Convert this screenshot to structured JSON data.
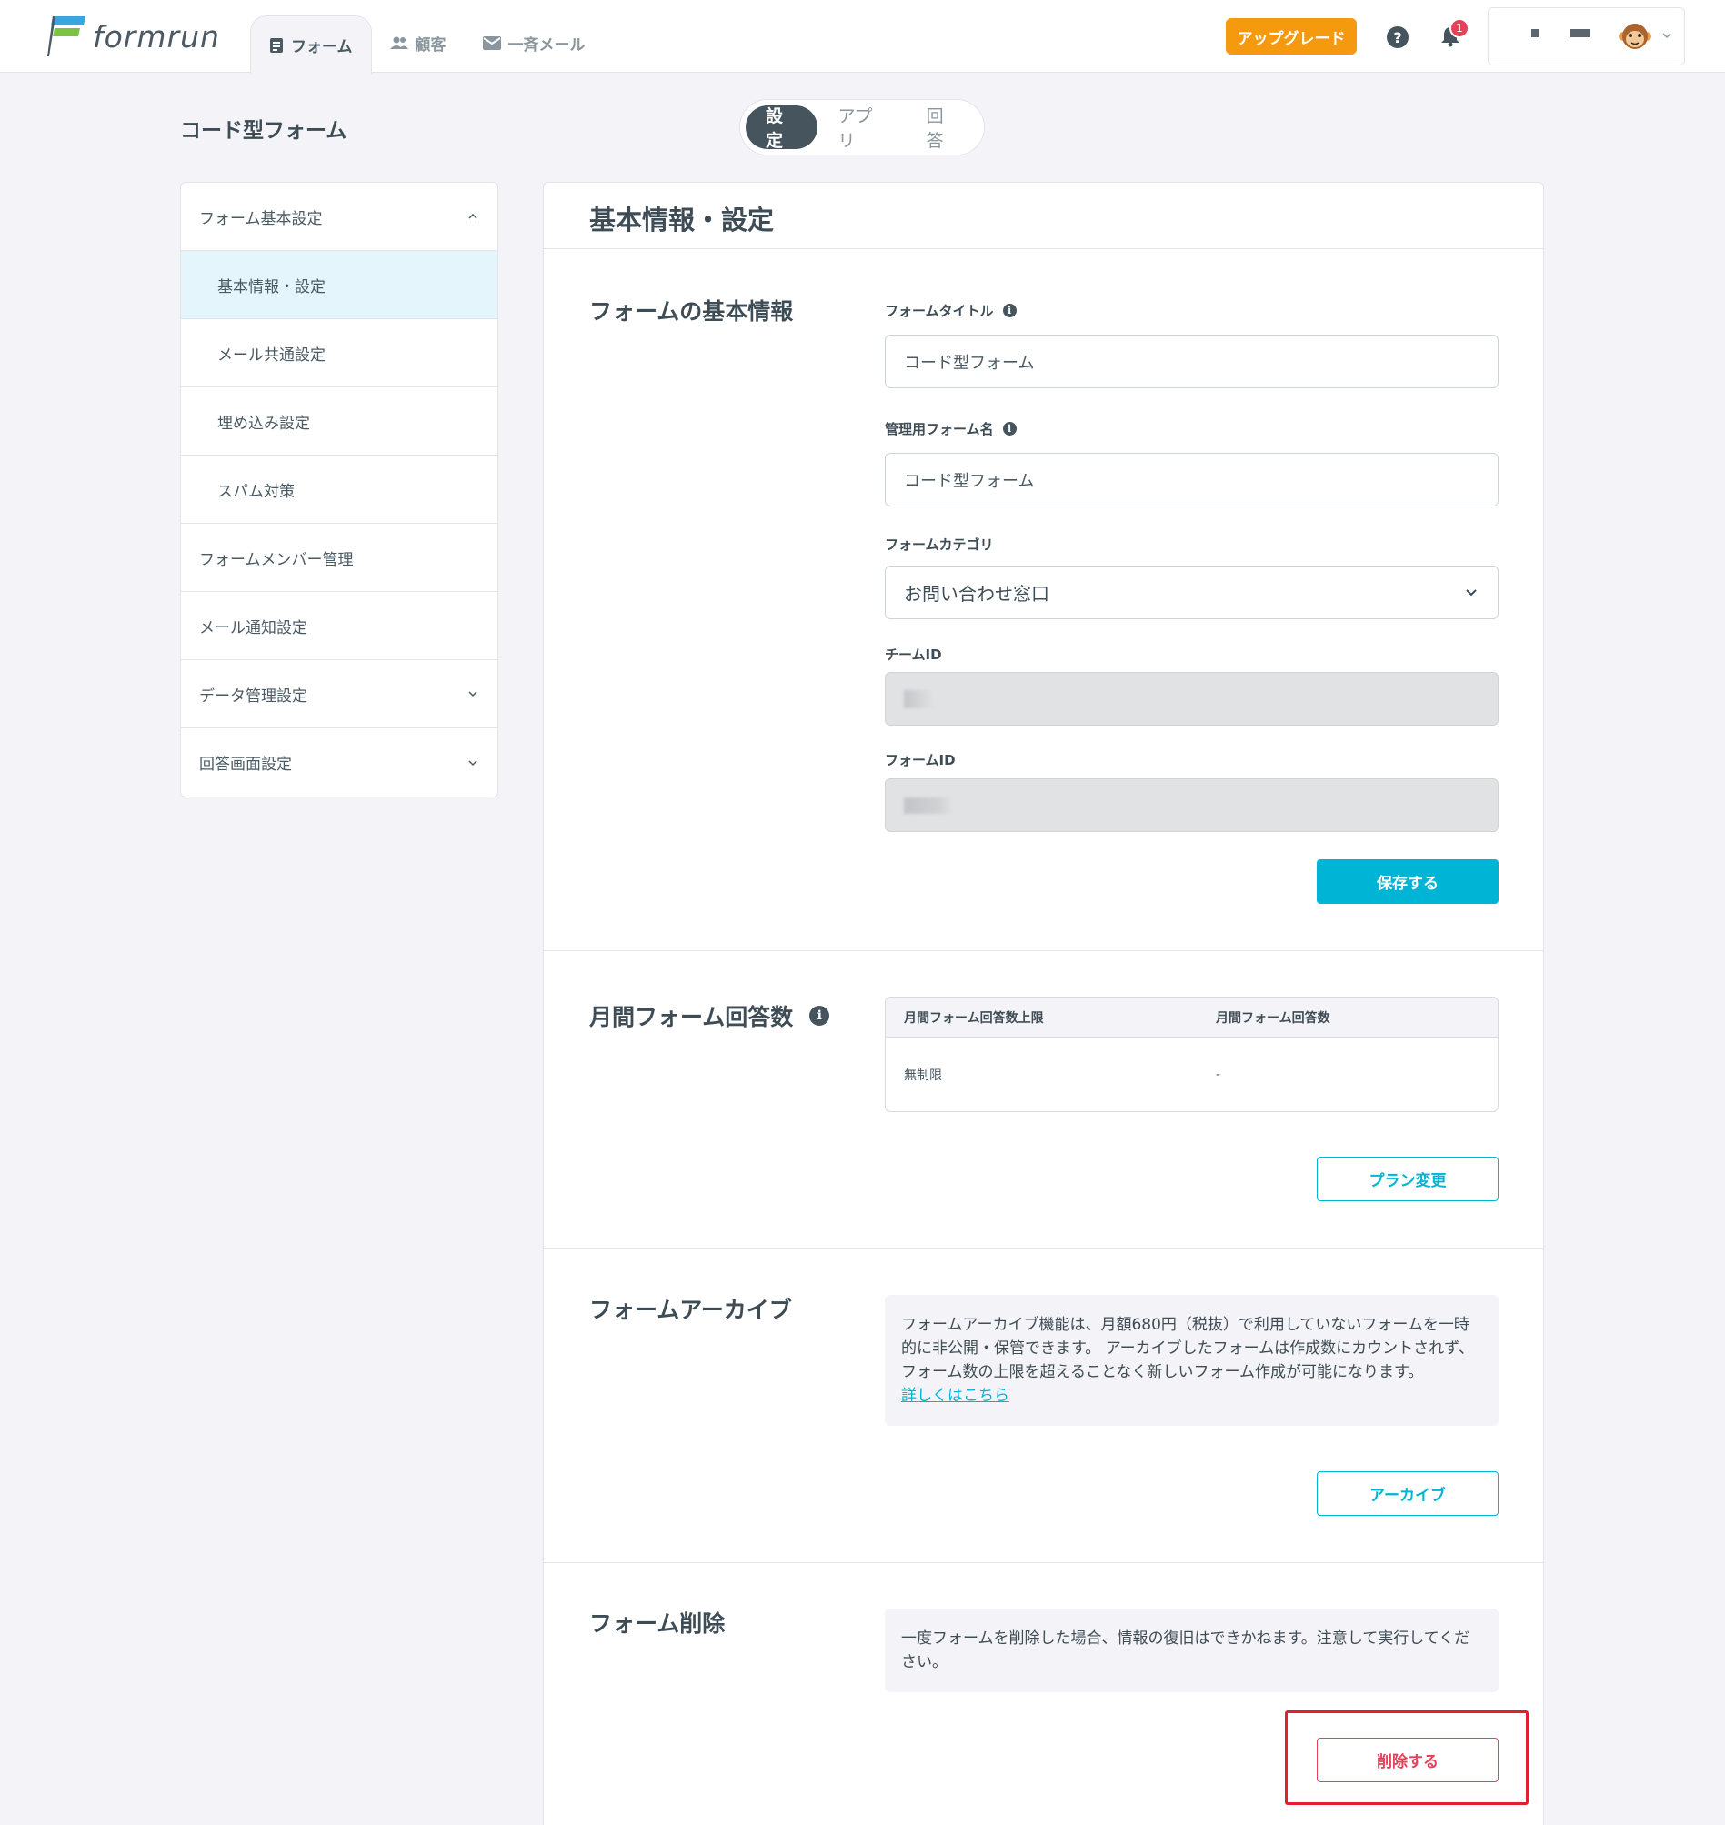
{
  "header": {
    "logo_text": "formrun",
    "tabs": [
      {
        "label": "フォーム",
        "icon": "document-icon",
        "active": true
      },
      {
        "label": "顧客",
        "icon": "people-icon",
        "active": false
      },
      {
        "label": "一斉メール",
        "icon": "mail-icon",
        "active": false
      }
    ],
    "upgrade_label": "アップグレード",
    "help_label": "?",
    "notification_count": "1"
  },
  "page": {
    "title": "コード型フォーム",
    "segments": [
      {
        "label": "設定",
        "active": true
      },
      {
        "label": "アプリ",
        "active": false
      },
      {
        "label": "回答",
        "active": false
      }
    ]
  },
  "sidebar": {
    "items": [
      {
        "label": "フォーム基本設定",
        "sub": false,
        "active": false,
        "chevron": "up"
      },
      {
        "label": "基本情報・設定",
        "sub": true,
        "active": true,
        "chevron": ""
      },
      {
        "label": "メール共通設定",
        "sub": true,
        "active": false,
        "chevron": ""
      },
      {
        "label": "埋め込み設定",
        "sub": true,
        "active": false,
        "chevron": ""
      },
      {
        "label": "スパム対策",
        "sub": true,
        "active": false,
        "chevron": ""
      },
      {
        "label": "フォームメンバー管理",
        "sub": false,
        "active": false,
        "chevron": ""
      },
      {
        "label": "メール通知設定",
        "sub": false,
        "active": false,
        "chevron": ""
      },
      {
        "label": "データ管理設定",
        "sub": false,
        "active": false,
        "chevron": "down"
      },
      {
        "label": "回答画面設定",
        "sub": false,
        "active": false,
        "chevron": "down"
      }
    ]
  },
  "main": {
    "title": "基本情報・設定",
    "basic_info": {
      "section_title": "フォームの基本情報",
      "form_title_label": "フォームタイトル",
      "form_title_value": "コード型フォーム",
      "admin_name_label": "管理用フォーム名",
      "admin_name_value": "コード型フォーム",
      "category_label": "フォームカテゴリ",
      "category_value": "お問い合わせ窓口",
      "team_id_label": "チームID",
      "form_id_label": "フォームID",
      "save_label": "保存する"
    },
    "monthly": {
      "section_title": "月間フォーム回答数",
      "col_limit": "月間フォーム回答数上限",
      "col_count": "月間フォーム回答数",
      "limit_value": "無制限",
      "count_value": "-",
      "plan_change_label": "プラン変更"
    },
    "archive": {
      "section_title": "フォームアーカイブ",
      "note_text": "フォームアーカイブ機能は、月額680円（税抜）で利用していないフォームを一時的に非公開・保管できます。 アーカイブしたフォームは作成数にカウントされず、フォーム数の上限を超えることなく新しいフォーム作成が可能になります。",
      "link_text": "詳しくはこちら",
      "archive_label": "アーカイブ"
    },
    "delete": {
      "section_title": "フォーム削除",
      "note_text": "一度フォームを削除した場合、情報の復旧はできかねます。注意して実行してください。",
      "delete_label": "削除する"
    }
  },
  "colors": {
    "accent": "#00b4d5",
    "upgrade": "#f59a0f",
    "danger": "#e5425a",
    "highlight": "#e0202e"
  }
}
